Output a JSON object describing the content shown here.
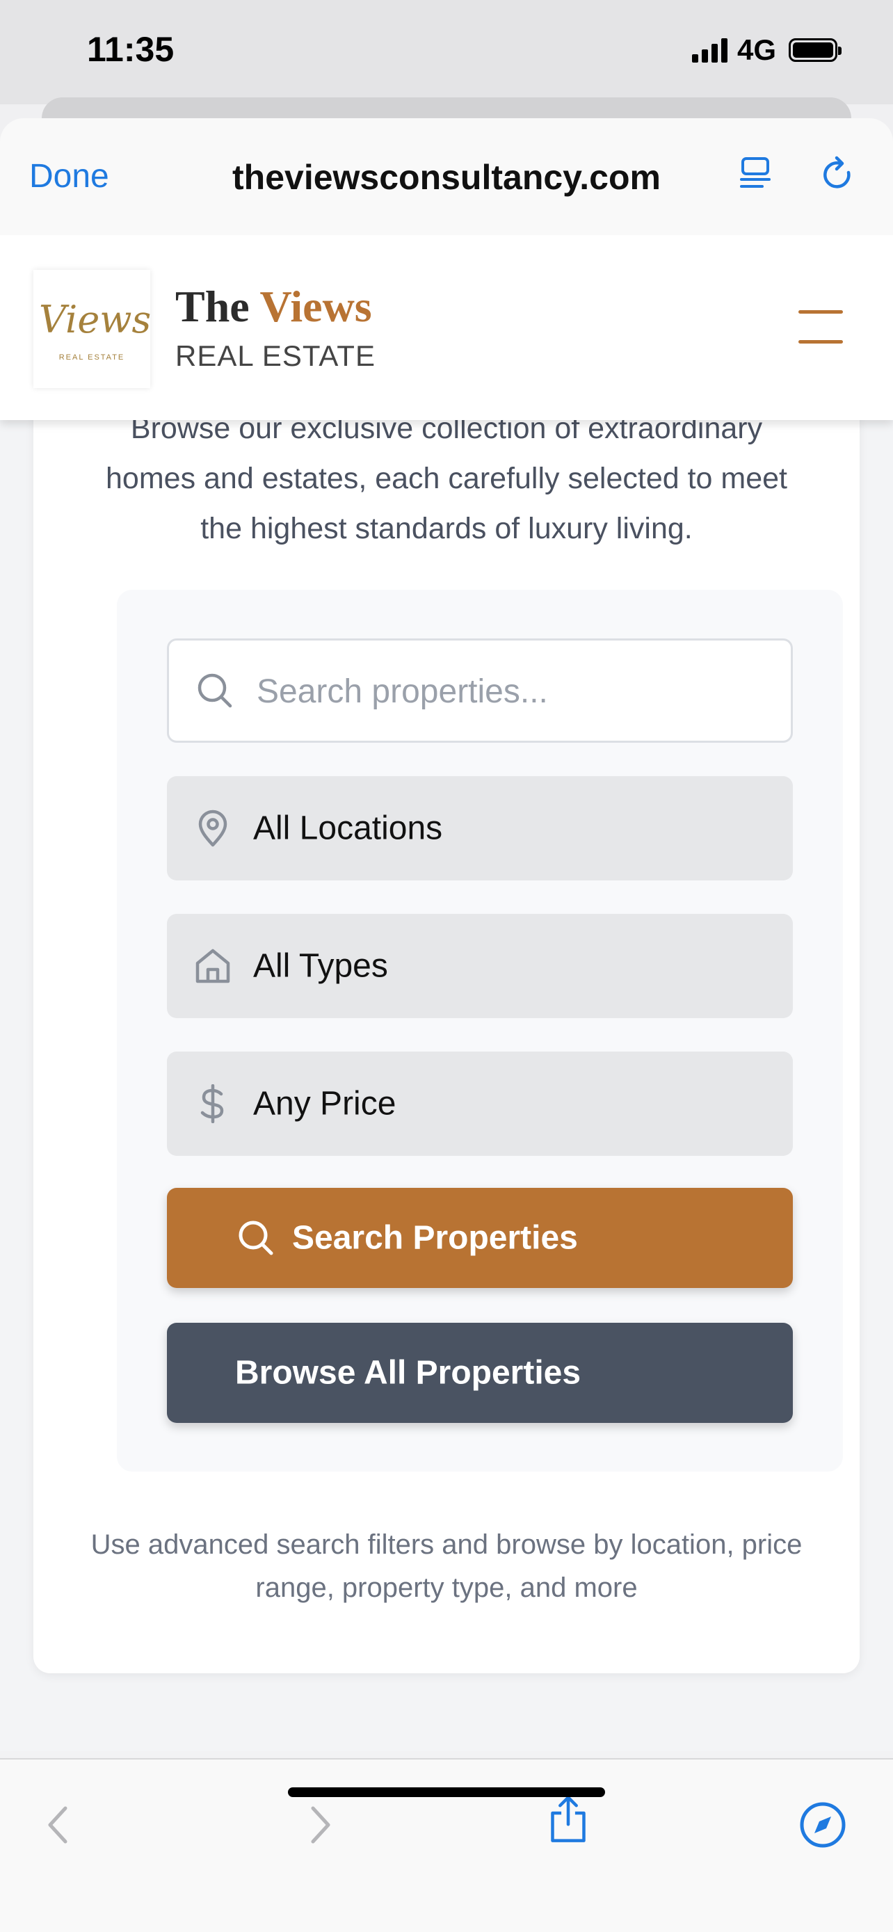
{
  "status_bar": {
    "time": "11:35",
    "network": "4G"
  },
  "browser": {
    "done_label": "Done",
    "url": "theviewsconsultancy.com",
    "accent_color": "#1f7ae0"
  },
  "site": {
    "logo_script": "Views",
    "logo_sub": "REAL ESTATE",
    "brand_title_part1": "The ",
    "brand_title_part2": "Views",
    "brand_subtitle": "REAL ESTATE",
    "brand_accent_color": "#b87333",
    "hero_description": "Browse our exclusive collection of extraordinary homes and estates, each carefully selected to meet the highest standards of luxury living.",
    "search": {
      "placeholder": "Search properties...",
      "location_value": "All Locations",
      "type_value": "All Types",
      "price_value": "Any Price",
      "search_button": "Search Properties",
      "browse_button": "Browse All Properties"
    },
    "helper_text": "Use advanced search filters and browse by location, price range, property type, and more"
  }
}
